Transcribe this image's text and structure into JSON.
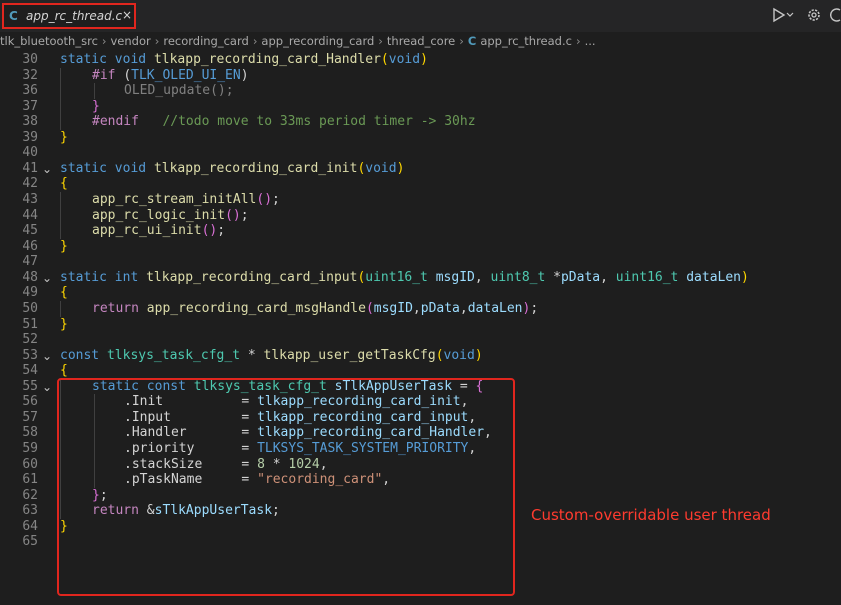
{
  "tab": {
    "lang_icon": "C",
    "filename": "app_rc_thread.c",
    "close": "×"
  },
  "top_icons": {
    "run": "run-debug-icon",
    "settings": "gear-icon",
    "history": "history-icon"
  },
  "breadcrumb": [
    "tlk_bluetooth_src",
    "vendor",
    "recording_card",
    "app_recording_card",
    "thread_core",
    "app_rc_thread.c",
    "..."
  ],
  "annotation": "Custom-overridable user thread",
  "code_lines": [
    {
      "n": "30",
      "fold": "",
      "indent": 0,
      "tokens": [
        [
          "kw",
          "static "
        ],
        [
          "kw",
          "void "
        ],
        [
          "fn",
          "tlkapp_recording_card_Handler"
        ],
        [
          "br",
          "("
        ],
        [
          "kw",
          "void"
        ],
        [
          "br",
          ")"
        ]
      ]
    },
    {
      "n": "32",
      "fold": "",
      "indent": 1,
      "tokens": [
        [
          "pp",
          "#if "
        ],
        [
          "pl",
          "("
        ],
        [
          "mac",
          "TLK_OLED_UI_EN"
        ],
        [
          "pl",
          ")"
        ]
      ]
    },
    {
      "n": "36",
      "fold": "",
      "indent": 2,
      "tokens": [
        [
          "dim",
          "OLED_update();"
        ]
      ]
    },
    {
      "n": "37",
      "fold": "",
      "indent": 1,
      "tokens": [
        [
          "br2",
          "}"
        ]
      ]
    },
    {
      "n": "38",
      "fold": "",
      "indent": 1,
      "tokens": [
        [
          "pp",
          "#endif"
        ],
        [
          "pl",
          "   "
        ],
        [
          "cm",
          "//todo move to 33ms period timer -> 30hz"
        ]
      ]
    },
    {
      "n": "39",
      "fold": "",
      "indent": 0,
      "tokens": [
        [
          "br",
          "}"
        ]
      ]
    },
    {
      "n": "40",
      "fold": "",
      "indent": 0,
      "tokens": []
    },
    {
      "n": "41",
      "fold": "⌄",
      "indent": 0,
      "tokens": [
        [
          "kw",
          "static "
        ],
        [
          "kw",
          "void "
        ],
        [
          "fn",
          "tlkapp_recording_card_init"
        ],
        [
          "br",
          "("
        ],
        [
          "kw",
          "void"
        ],
        [
          "br",
          ")"
        ]
      ]
    },
    {
      "n": "42",
      "fold": "",
      "indent": 0,
      "tokens": [
        [
          "br",
          "{"
        ]
      ]
    },
    {
      "n": "43",
      "fold": "",
      "indent": 1,
      "tokens": [
        [
          "fn",
          "app_rc_stream_initAll"
        ],
        [
          "br2",
          "()"
        ],
        [
          "pl",
          ";"
        ]
      ]
    },
    {
      "n": "44",
      "fold": "",
      "indent": 1,
      "tokens": [
        [
          "fn",
          "app_rc_logic_init"
        ],
        [
          "br2",
          "()"
        ],
        [
          "pl",
          ";"
        ]
      ]
    },
    {
      "n": "45",
      "fold": "",
      "indent": 1,
      "tokens": [
        [
          "fn",
          "app_rc_ui_init"
        ],
        [
          "br2",
          "()"
        ],
        [
          "pl",
          ";"
        ]
      ]
    },
    {
      "n": "46",
      "fold": "",
      "indent": 0,
      "tokens": [
        [
          "br",
          "}"
        ]
      ]
    },
    {
      "n": "47",
      "fold": "",
      "indent": 0,
      "tokens": []
    },
    {
      "n": "48",
      "fold": "⌄",
      "indent": 0,
      "tokens": [
        [
          "kw",
          "static "
        ],
        [
          "kw",
          "int "
        ],
        [
          "fn",
          "tlkapp_recording_card_input"
        ],
        [
          "br",
          "("
        ],
        [
          "ty",
          "uint16_t "
        ],
        [
          "pm",
          "msgID"
        ],
        [
          "pl",
          ", "
        ],
        [
          "ty",
          "uint8_t "
        ],
        [
          "pl",
          "*"
        ],
        [
          "pm",
          "pData"
        ],
        [
          "pl",
          ", "
        ],
        [
          "ty",
          "uint16_t "
        ],
        [
          "pm",
          "dataLen"
        ],
        [
          "br",
          ")"
        ]
      ]
    },
    {
      "n": "49",
      "fold": "",
      "indent": 0,
      "tokens": [
        [
          "br",
          "{"
        ]
      ]
    },
    {
      "n": "50",
      "fold": "",
      "indent": 1,
      "tokens": [
        [
          "pp",
          "return "
        ],
        [
          "fn",
          "app_recording_card_msgHandle"
        ],
        [
          "br2",
          "("
        ],
        [
          "pm",
          "msgID"
        ],
        [
          "pl",
          ","
        ],
        [
          "pm",
          "pData"
        ],
        [
          "pl",
          ","
        ],
        [
          "pm",
          "dataLen"
        ],
        [
          "br2",
          ")"
        ],
        [
          "pl",
          ";"
        ]
      ]
    },
    {
      "n": "51",
      "fold": "",
      "indent": 0,
      "tokens": [
        [
          "br",
          "}"
        ]
      ]
    },
    {
      "n": "52",
      "fold": "",
      "indent": 0,
      "tokens": []
    },
    {
      "n": "53",
      "fold": "⌄",
      "indent": 0,
      "tokens": [
        [
          "kw",
          "const "
        ],
        [
          "ty",
          "tlksys_task_cfg_t "
        ],
        [
          "pl",
          "* "
        ],
        [
          "fn",
          "tlkapp_user_getTaskCfg"
        ],
        [
          "br",
          "("
        ],
        [
          "kw",
          "void"
        ],
        [
          "br",
          ")"
        ]
      ]
    },
    {
      "n": "54",
      "fold": "",
      "indent": 0,
      "tokens": [
        [
          "br",
          "{"
        ]
      ]
    },
    {
      "n": "55",
      "fold": "⌄",
      "indent": 1,
      "tokens": [
        [
          "kw",
          "static "
        ],
        [
          "kw",
          "const "
        ],
        [
          "ty",
          "tlksys_task_cfg_t "
        ],
        [
          "pm",
          "sTlkAppUserTask"
        ],
        [
          "pl",
          " = "
        ],
        [
          "br2",
          "{"
        ]
      ]
    },
    {
      "n": "56",
      "fold": "",
      "indent": 2,
      "tokens": [
        [
          "pl",
          ".Init          = "
        ],
        [
          "pm",
          "tlkapp_recording_card_init"
        ],
        [
          "pl",
          ","
        ]
      ]
    },
    {
      "n": "57",
      "fold": "",
      "indent": 2,
      "tokens": [
        [
          "pl",
          ".Input         = "
        ],
        [
          "pm",
          "tlkapp_recording_card_input"
        ],
        [
          "pl",
          ","
        ]
      ]
    },
    {
      "n": "58",
      "fold": "",
      "indent": 2,
      "tokens": [
        [
          "pl",
          ".Handler       = "
        ],
        [
          "pm",
          "tlkapp_recording_card_Handler"
        ],
        [
          "pl",
          ","
        ]
      ]
    },
    {
      "n": "59",
      "fold": "",
      "indent": 2,
      "tokens": [
        [
          "pl",
          ".priority      = "
        ],
        [
          "mac",
          "TLKSYS_TASK_SYSTEM_PRIORITY"
        ],
        [
          "pl",
          ","
        ]
      ]
    },
    {
      "n": "60",
      "fold": "",
      "indent": 2,
      "tokens": [
        [
          "pl",
          ".stackSize     = "
        ],
        [
          "nm",
          "8"
        ],
        [
          "pl",
          " * "
        ],
        [
          "nm",
          "1024"
        ],
        [
          "pl",
          ","
        ]
      ]
    },
    {
      "n": "61",
      "fold": "",
      "indent": 2,
      "tokens": [
        [
          "pl",
          ".pTaskName     = "
        ],
        [
          "st",
          "\"recording_card\""
        ],
        [
          "pl",
          ","
        ]
      ]
    },
    {
      "n": "62",
      "fold": "",
      "indent": 1,
      "tokens": [
        [
          "br2",
          "}"
        ],
        [
          "pl",
          ";"
        ]
      ]
    },
    {
      "n": "63",
      "fold": "",
      "indent": 1,
      "tokens": [
        [
          "pp",
          "return "
        ],
        [
          "pl",
          "&"
        ],
        [
          "pm",
          "sTlkAppUserTask"
        ],
        [
          "pl",
          ";"
        ]
      ]
    },
    {
      "n": "64",
      "fold": "",
      "indent": 0,
      "tokens": [
        [
          "br",
          "}"
        ]
      ]
    },
    {
      "n": "65",
      "fold": "",
      "indent": 0,
      "tokens": []
    }
  ]
}
